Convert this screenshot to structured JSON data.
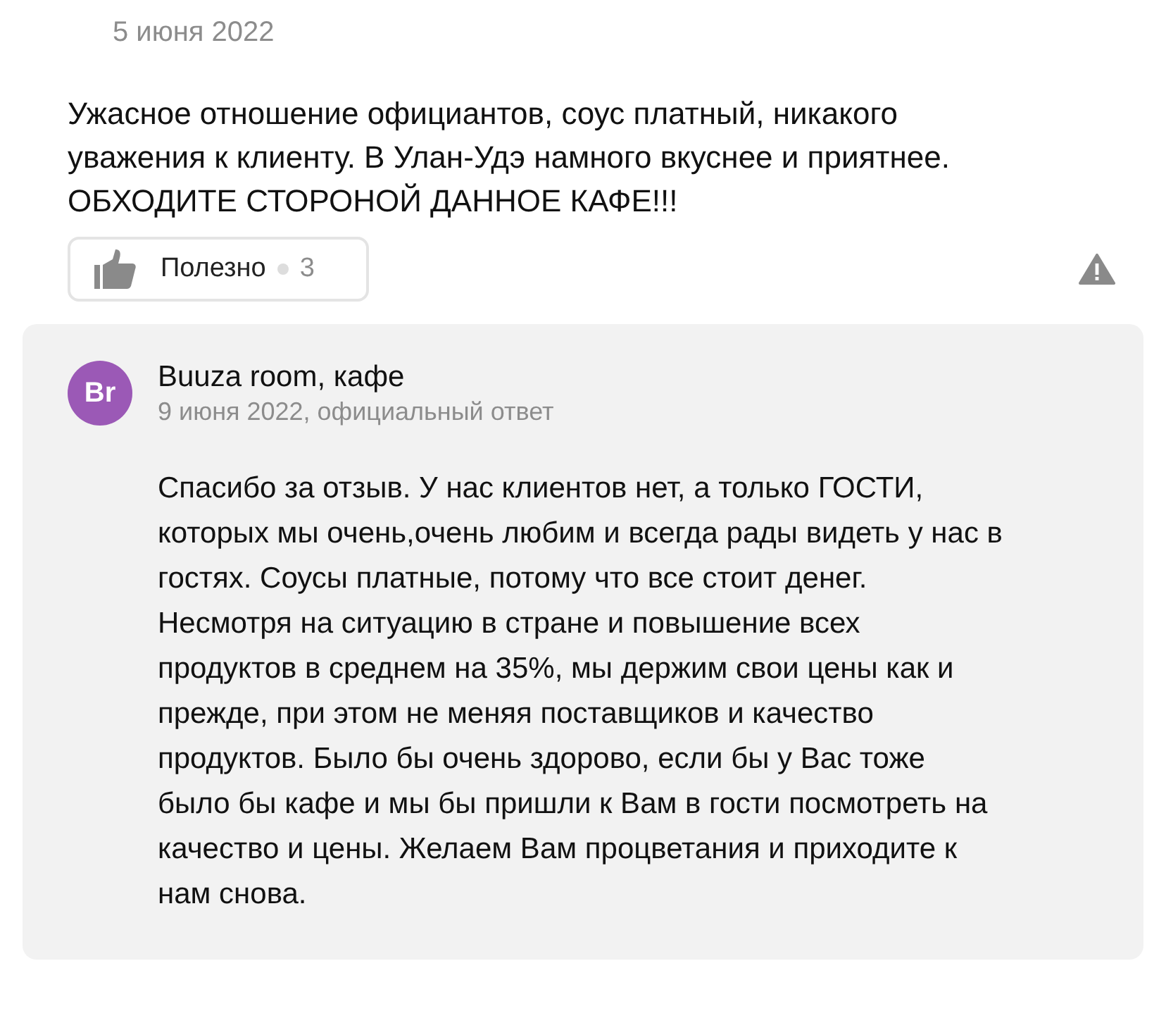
{
  "review": {
    "date": "5 июня 2022",
    "text": "Ужасное отношение официантов, соус платный, никакого уважения к клиенту. В Улан-Удэ намного вкуснее и приятнее. ОБХОДИТЕ СТОРОНОЙ ДАННОЕ КАФЕ!!!",
    "helpful": {
      "label": "Полезно",
      "count": "3"
    }
  },
  "reply": {
    "avatar": "Br",
    "name": "Buuza room, кафе",
    "meta": "9 июня 2022, официальный ответ",
    "text": "Спасибо за отзыв. У нас клиентов нет, а только ГОСТИ, которых мы очень,очень любим и всегда рады видеть у нас в гостях. Соусы платные, потому что все стоит денег. Несмотря на ситуацию в стране и повышение всех продуктов в среднем на 35%, мы держим свои цены как и прежде, при этом не меняя поставщиков и качество продуктов. Было бы очень здорово, если бы у Вас тоже было бы кафе и мы бы пришли к Вам в гости посмотреть на качество и цены. Желаем Вам процветания и приходите к нам снова."
  }
}
